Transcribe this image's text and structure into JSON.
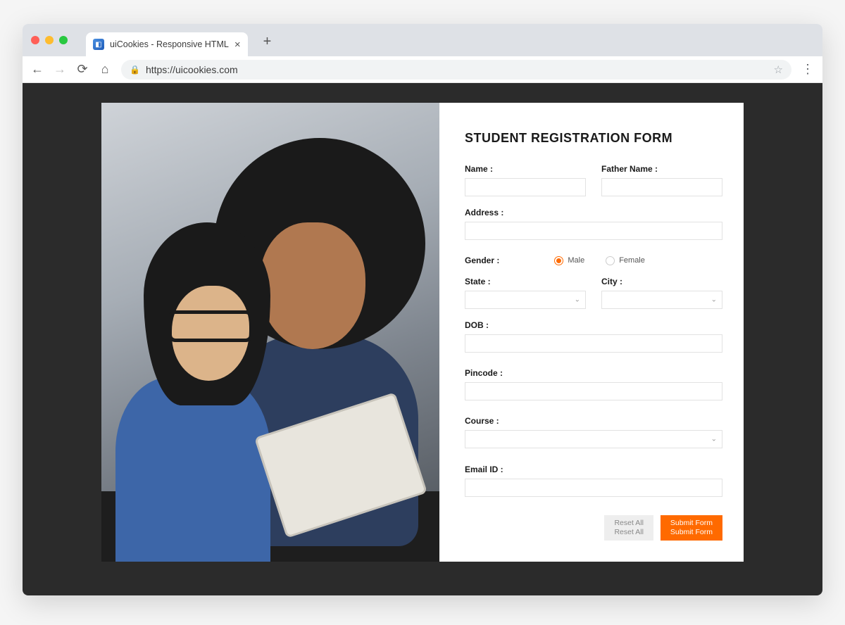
{
  "browser": {
    "tab_title": "uiCookies - Responsive HTML",
    "url": "https://uicookies.com"
  },
  "form": {
    "title": "STUDENT REGISTRATION FORM",
    "fields": {
      "name_label": "Name :",
      "father_name_label": "Father Name :",
      "address_label": "Address :",
      "gender_label": "Gender :",
      "gender_options": {
        "male": "Male",
        "female": "Female"
      },
      "gender_selected": "male",
      "state_label": "State :",
      "city_label": "City :",
      "dob_label": "DOB :",
      "pincode_label": "Pincode :",
      "course_label": "Course :",
      "email_label": "Email ID :"
    },
    "buttons": {
      "reset_line1": "Reset All",
      "reset_line2": "Reset All",
      "submit_line1": "Submit Form",
      "submit_line2": "Submit Form"
    }
  }
}
